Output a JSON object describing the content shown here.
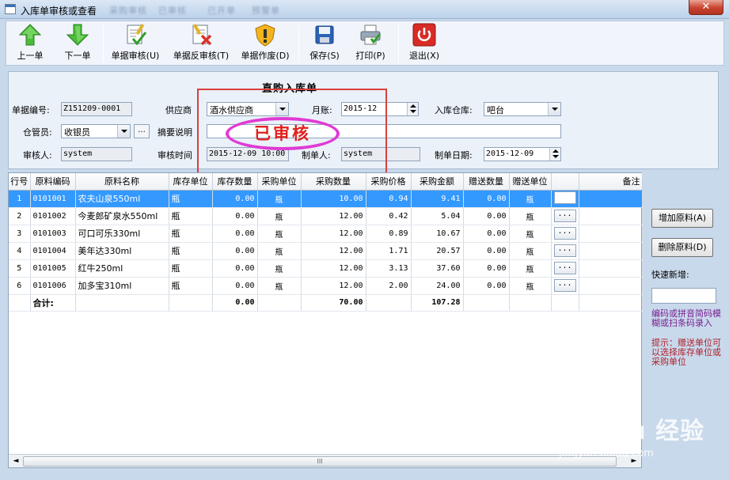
{
  "window": {
    "title": "入库单审核或查看",
    "close_glyph": "✕",
    "background_tabs": [
      "采购审核",
      "已审核",
      "已开单",
      "预警单"
    ]
  },
  "toolbar": {
    "buttons": [
      {
        "label": "上一单",
        "icon": "arrow-up-icon"
      },
      {
        "label": "下一单",
        "icon": "arrow-down-icon"
      },
      {
        "label": "单据审核(U)",
        "icon": "approve-document-icon"
      },
      {
        "label": "单据反审核(T)",
        "icon": "unapprove-document-icon"
      },
      {
        "label": "单据作废(D)",
        "icon": "void-shield-icon"
      },
      {
        "label": "保存(S)",
        "icon": "save-disk-icon"
      },
      {
        "label": "打印(P)",
        "icon": "printer-icon"
      },
      {
        "label": "退出(X)",
        "icon": "power-exit-icon"
      }
    ]
  },
  "form": {
    "doc_title": "直购入库单",
    "doc_no_label": "单据编号:",
    "doc_no": "Z151209-0001",
    "supplier_label": "供应商",
    "supplier": "酒水供应商",
    "account_month_label": "月账:",
    "account_month": "2015-12",
    "warehouse_label": "入库仓库:",
    "warehouse": "吧台",
    "keeper_label": "仓管员:",
    "keeper": "收银员",
    "ellipsis": "...",
    "summary_label": "摘要说明",
    "summary": "",
    "auditor_label": "审核人:",
    "auditor": "system",
    "audit_time_label": "审核时间",
    "audit_time": "2015-12-09 10:00",
    "maker_label": "制单人:",
    "maker": "system",
    "make_date_label": "制单日期:",
    "make_date": "2015-12-09",
    "stamp_text": "已审核",
    "stamp_color": "#e0201c"
  },
  "grid": {
    "columns": [
      "行号",
      "原料编码",
      "原料名称",
      "库存单位",
      "库存数量",
      "采购单位",
      "采购数量",
      "采购价格",
      "采购金额",
      "赠送数量",
      "赠送单位",
      "",
      "备注"
    ],
    "rows": [
      [
        "1",
        "0101001",
        "农夫山泉550ml",
        "瓶",
        "0.00",
        "瓶",
        "10.00",
        "0.94",
        "9.41",
        "0.00",
        "瓶",
        "",
        ""
      ],
      [
        "2",
        "0101002",
        "今麦郎矿泉水550ml",
        "瓶",
        "0.00",
        "瓶",
        "12.00",
        "0.42",
        "5.04",
        "0.00",
        "瓶",
        "...",
        ""
      ],
      [
        "3",
        "0101003",
        "可口可乐330ml",
        "瓶",
        "0.00",
        "瓶",
        "12.00",
        "0.89",
        "10.67",
        "0.00",
        "瓶",
        "...",
        ""
      ],
      [
        "4",
        "0101004",
        "美年达330ml",
        "瓶",
        "0.00",
        "瓶",
        "12.00",
        "1.71",
        "20.57",
        "0.00",
        "瓶",
        "...",
        ""
      ],
      [
        "5",
        "0101005",
        "红牛250ml",
        "瓶",
        "0.00",
        "瓶",
        "12.00",
        "3.13",
        "37.60",
        "0.00",
        "瓶",
        "...",
        ""
      ],
      [
        "6",
        "0101006",
        "加多宝310ml",
        "瓶",
        "0.00",
        "瓶",
        "12.00",
        "2.00",
        "24.00",
        "0.00",
        "瓶",
        "...",
        ""
      ]
    ],
    "total": {
      "label": "合计:",
      "stock_qty": "0.00",
      "purchase_qty": "70.00",
      "amount": "107.28"
    },
    "selected_row": 0,
    "selection_color": "#3399ff",
    "scroll_left": "◄",
    "scroll_right": "►",
    "scroll_grip": "III"
  },
  "side": {
    "add_button": "增加原料(A)",
    "delete_button": "删除原料(D)",
    "quick_add_label": "快速新增:",
    "quick_add_value": "",
    "hint_code": "编码或拼音简码模糊或扫条码录入",
    "hint_unit": "提示：赠送单位可以选择库存单位或采购单位"
  },
  "watermark": {
    "brand": "Bai du 经验",
    "url": "jingyan.baidu.com"
  }
}
